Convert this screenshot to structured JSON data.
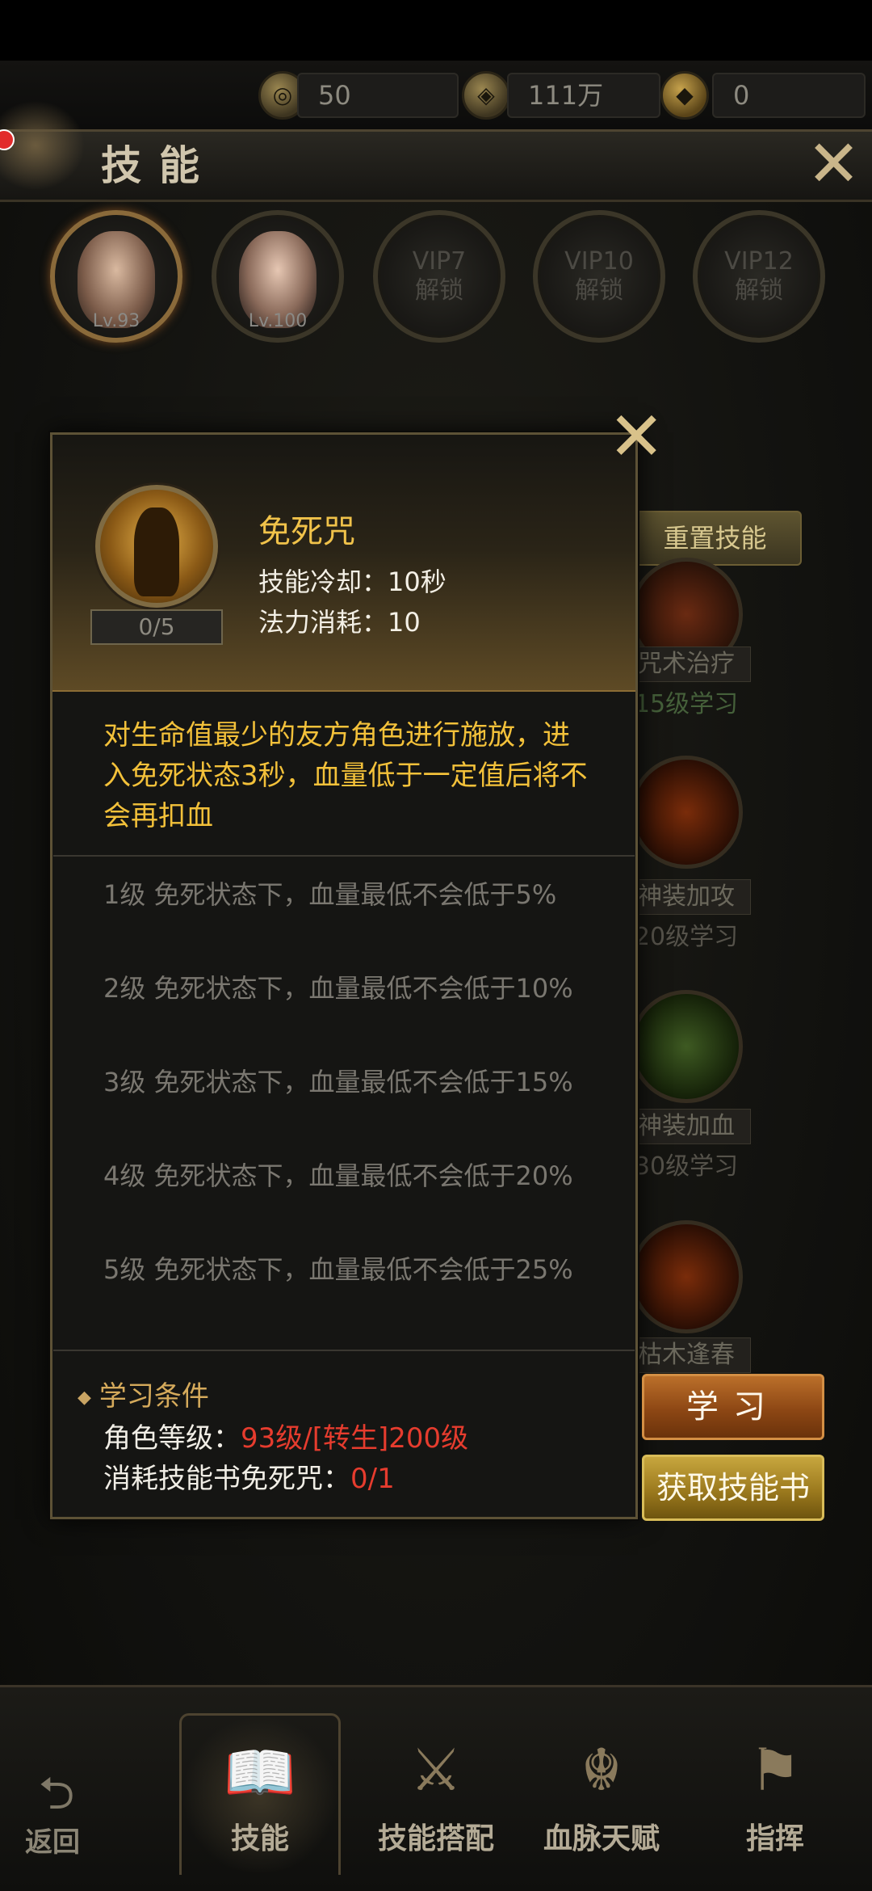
{
  "currency": {
    "a_value": "50",
    "b_value": "111万",
    "c_value": "0"
  },
  "header": {
    "title": "技能"
  },
  "heroes": [
    {
      "level": "Lv.93"
    },
    {
      "level": "Lv.100"
    },
    {
      "lock_vip": "VIP7",
      "lock_text": "解锁"
    },
    {
      "lock_vip": "VIP10",
      "lock_text": "解锁"
    },
    {
      "lock_vip": "VIP12",
      "lock_text": "解锁"
    }
  ],
  "background_panel": {
    "reset_label": "重置技能",
    "skills": [
      {
        "name": "咒术治疗",
        "req": "15级学习"
      },
      {
        "name": "神装加攻",
        "req": "20级学习"
      },
      {
        "name": "神装加血",
        "req": "30级学习"
      },
      {
        "name": "枯木逢春",
        "req": ""
      }
    ]
  },
  "popup": {
    "skill_name": "免死咒",
    "skill_level": "0/5",
    "cooldown": "技能冷却：10秒",
    "mana": "法力消耗：10",
    "description": "对生命值最少的友方角色进行施放，进入免死状态3秒，血量低于一定值后将不会再扣血",
    "levels": [
      "1级 免死状态下，血量最低不会低于5%",
      "2级 免死状态下，血量最低不会低于10%",
      "3级 免死状态下，血量最低不会低于15%",
      "4级 免死状态下，血量最低不会低于20%",
      "5级 免死状态下，血量最低不会低于25%"
    ],
    "conditions_title": "学习条件",
    "cond1_label": "角色等级：",
    "cond1_value": "93级/[转生]200级",
    "cond2_label": "消耗技能书免死咒：",
    "cond2_value": "0/1"
  },
  "buttons": {
    "learn": "学习",
    "get_book": "获取技能书"
  },
  "nav": {
    "back": "返回",
    "items": [
      "技能",
      "技能搭配",
      "血脉天赋",
      "指挥"
    ]
  },
  "icons": {
    "close": "close-icon",
    "currency_a": "coin-icon",
    "currency_b": "copper-coin-icon",
    "currency_c": "ingot-icon"
  },
  "colors": {
    "accent_gold": "#f0c24a",
    "condition_red": "#e63c2e",
    "learn_button": "#8d4714",
    "get_button": "#9c7a1e"
  }
}
